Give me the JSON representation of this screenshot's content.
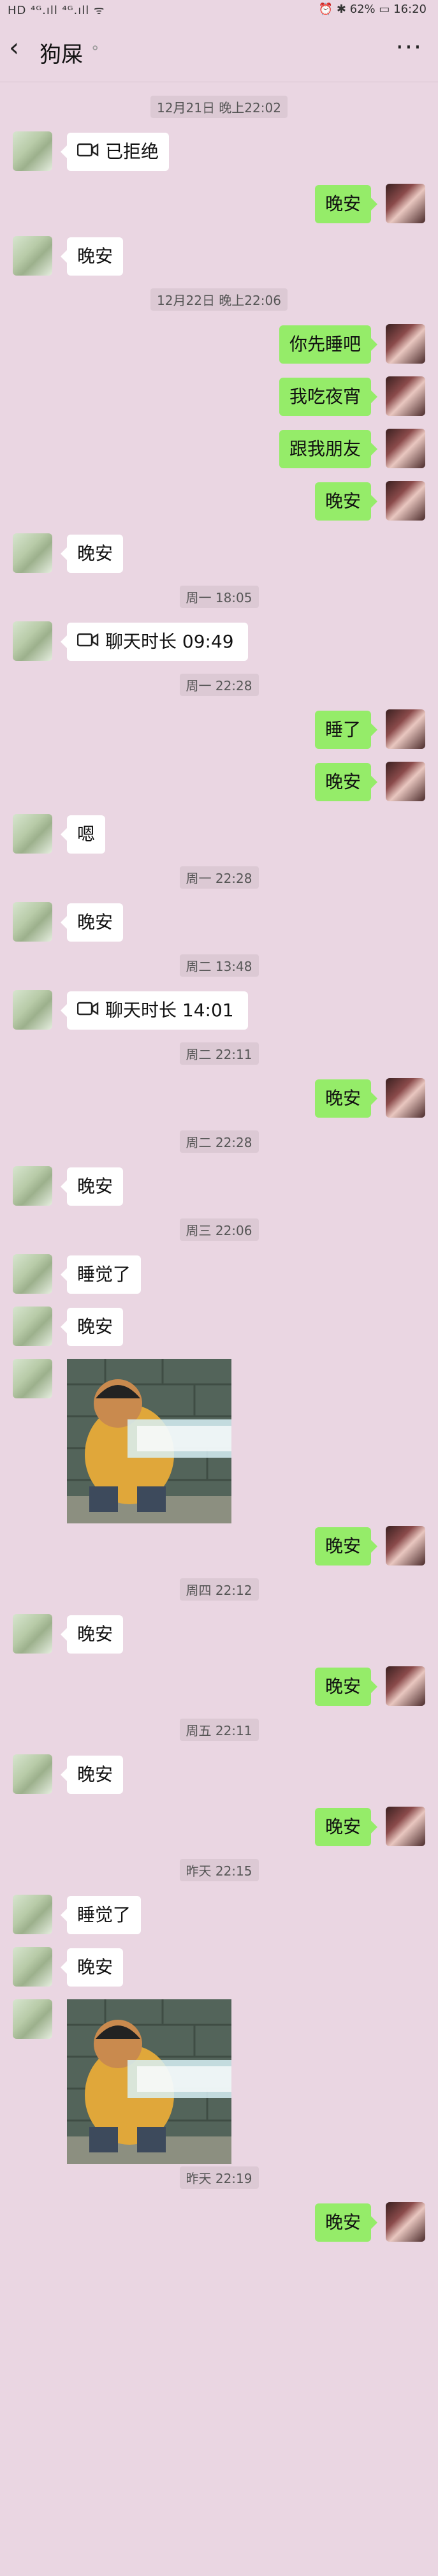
{
  "status_bar": {
    "left": "HD ⁴ᴳ.ıll ⁴ᴳ.ıll ᯤ",
    "right": "⏰ ✱ 62% ▭ 16:20"
  },
  "header": {
    "back_icon": "chevron-left-icon",
    "title": "狗屎",
    "mute_icon": "mute-icon",
    "more_label": "···"
  },
  "messages": [
    {
      "kind": "time",
      "text": "12月21日 晚上22:02"
    },
    {
      "kind": "video",
      "side": "left",
      "text": "已拒绝"
    },
    {
      "kind": "text",
      "side": "right",
      "text": "晚安"
    },
    {
      "kind": "text",
      "side": "left",
      "text": "晚安"
    },
    {
      "kind": "time",
      "text": "12月22日 晚上22:06"
    },
    {
      "kind": "text",
      "side": "right",
      "text": "你先睡吧"
    },
    {
      "kind": "text",
      "side": "right",
      "text": "我吃夜宵"
    },
    {
      "kind": "text",
      "side": "right",
      "text": "跟我朋友"
    },
    {
      "kind": "text",
      "side": "right",
      "text": "晚安"
    },
    {
      "kind": "text",
      "side": "left",
      "text": "晚安"
    },
    {
      "kind": "time",
      "text": "周一 18:05"
    },
    {
      "kind": "video",
      "side": "left",
      "text": "聊天时长 09:49"
    },
    {
      "kind": "time",
      "text": "周一 22:28"
    },
    {
      "kind": "text",
      "side": "right",
      "text": "睡了"
    },
    {
      "kind": "text",
      "side": "right",
      "text": "晚安"
    },
    {
      "kind": "text",
      "side": "left",
      "text": "嗯"
    },
    {
      "kind": "time",
      "text": "周一 22:28"
    },
    {
      "kind": "text",
      "side": "left",
      "text": "晚安"
    },
    {
      "kind": "time",
      "text": "周二 13:48"
    },
    {
      "kind": "video",
      "side": "left",
      "text": "聊天时长 14:01"
    },
    {
      "kind": "time",
      "text": "周二 22:11"
    },
    {
      "kind": "text",
      "side": "right",
      "text": "晚安"
    },
    {
      "kind": "time",
      "text": "周二 22:28"
    },
    {
      "kind": "text",
      "side": "left",
      "text": "晚安"
    },
    {
      "kind": "time",
      "text": "周三 22:06"
    },
    {
      "kind": "text",
      "side": "left",
      "text": "睡觉了"
    },
    {
      "kind": "text",
      "side": "left",
      "text": "晚安"
    },
    {
      "kind": "sticker",
      "side": "left"
    },
    {
      "kind": "text",
      "side": "right",
      "text": "晚安"
    },
    {
      "kind": "time",
      "text": "周四 22:12"
    },
    {
      "kind": "text",
      "side": "left",
      "text": "晚安"
    },
    {
      "kind": "text",
      "side": "right",
      "text": "晚安"
    },
    {
      "kind": "time",
      "text": "周五 22:11"
    },
    {
      "kind": "text",
      "side": "left",
      "text": "晚安"
    },
    {
      "kind": "text",
      "side": "right",
      "text": "晚安"
    },
    {
      "kind": "time",
      "text": "昨天 22:15"
    },
    {
      "kind": "text",
      "side": "left",
      "text": "睡觉了"
    },
    {
      "kind": "text",
      "side": "left",
      "text": "晚安"
    },
    {
      "kind": "sticker",
      "side": "left"
    },
    {
      "kind": "time",
      "text": "昨天 22:19"
    },
    {
      "kind": "text",
      "side": "right",
      "text": "晚安"
    }
  ],
  "colors": {
    "background": "#ead6e2",
    "bubble_self": "#95ec69",
    "bubble_other": "#ffffff"
  }
}
